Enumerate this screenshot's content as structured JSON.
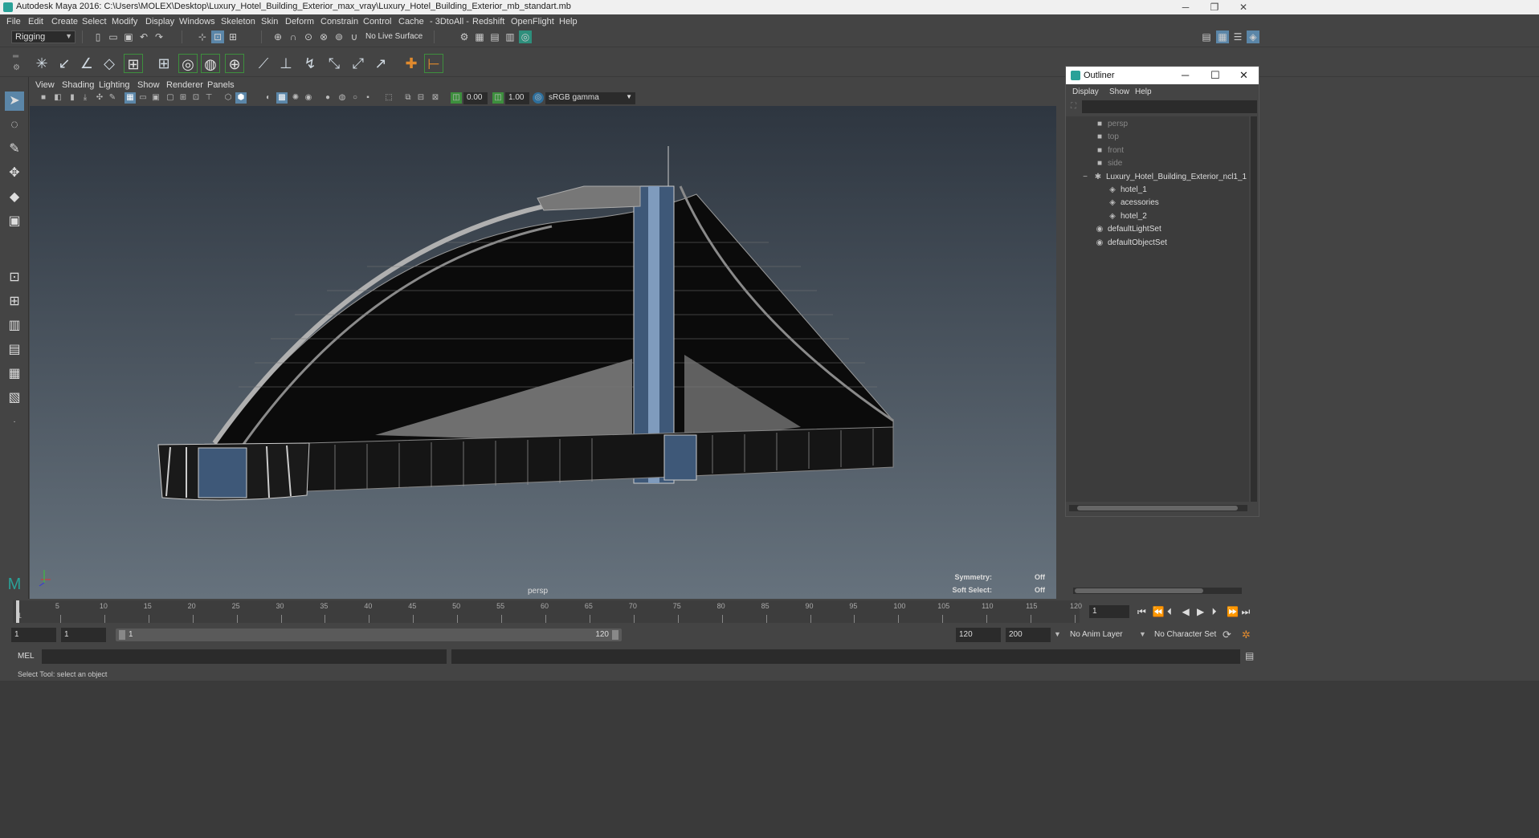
{
  "window": {
    "title": "Autodesk Maya 2016: C:\\Users\\MOLEX\\Desktop\\Luxury_Hotel_Building_Exterior_max_vray\\Luxury_Hotel_Building_Exterior_mb_standart.mb",
    "minimize": "─",
    "maximize": "❐",
    "close": "✕"
  },
  "menubar": [
    "File",
    "Edit",
    "Create",
    "Select",
    "Modify",
    "Display",
    "Windows",
    "Skeleton",
    "Skin",
    "Deform",
    "Constrain",
    "Control",
    "Cache",
    "- 3DtoAll -",
    "Redshift",
    "OpenFlight",
    "Help"
  ],
  "statusline": {
    "menuset": "Rigging",
    "live_surface": "No Live Surface"
  },
  "viewport": {
    "menus": [
      "View",
      "Shading",
      "Lighting",
      "Show",
      "Renderer",
      "Panels"
    ],
    "camera_label": "persp",
    "exposure": "0.00",
    "gamma": "1.00",
    "color_space": "sRGB gamma",
    "hud": {
      "symmetry_label": "Symmetry:",
      "symmetry_value": "Off",
      "soft_select_label": "Soft Select:",
      "soft_select_value": "Off"
    }
  },
  "outliner": {
    "title": "Outliner",
    "minimize": "─",
    "maximize": "☐",
    "close": "✕",
    "menus": [
      "Display",
      "Show",
      "Help"
    ],
    "items": [
      {
        "label": "persp",
        "icon": "camera-icon",
        "glyph": "■",
        "indent": 0,
        "dim": true
      },
      {
        "label": "top",
        "icon": "camera-icon",
        "glyph": "■",
        "indent": 0,
        "dim": true
      },
      {
        "label": "front",
        "icon": "camera-icon",
        "glyph": "■",
        "indent": 0,
        "dim": true
      },
      {
        "label": "side",
        "icon": "camera-icon",
        "glyph": "■",
        "indent": 0,
        "dim": true
      },
      {
        "label": "Luxury_Hotel_Building_Exterior_ncl1_1",
        "icon": "group-icon",
        "glyph": "✱",
        "indent": 0,
        "dim": false,
        "expander": "−"
      },
      {
        "label": "hotel_1",
        "icon": "mesh-icon",
        "glyph": "◈",
        "indent": 1,
        "dim": false
      },
      {
        "label": "acessories",
        "icon": "mesh-icon",
        "glyph": "◈",
        "indent": 1,
        "dim": false
      },
      {
        "label": "hotel_2",
        "icon": "mesh-icon",
        "glyph": "◈",
        "indent": 1,
        "dim": false
      },
      {
        "label": "defaultLightSet",
        "icon": "set-icon",
        "glyph": "◉",
        "indent": 0,
        "dim": false
      },
      {
        "label": "defaultObjectSet",
        "icon": "set-icon",
        "glyph": "◉",
        "indent": 0,
        "dim": false
      }
    ]
  },
  "timeslider": {
    "ticks": [
      "5",
      "10",
      "15",
      "20",
      "25",
      "30",
      "35",
      "40",
      "45",
      "50",
      "55",
      "60",
      "65",
      "70",
      "75",
      "80",
      "85",
      "90",
      "95",
      "100",
      "105",
      "110",
      "115",
      "120"
    ],
    "start_label": "1",
    "current_frame": "1",
    "playback": [
      "⏮",
      "⏪",
      "⏴",
      "◀",
      "▶",
      "⏵",
      "⏩",
      "⏭"
    ]
  },
  "rangeslider": {
    "start": "1",
    "playback_start": "1",
    "bar_start": "1",
    "bar_end": "120",
    "playback_end": "120",
    "end": "200",
    "anim_layer": "No Anim Layer",
    "character_set": "No Character Set"
  },
  "cmdline": {
    "label": "MEL"
  },
  "helpline": {
    "text": "Select Tool: select an object"
  }
}
